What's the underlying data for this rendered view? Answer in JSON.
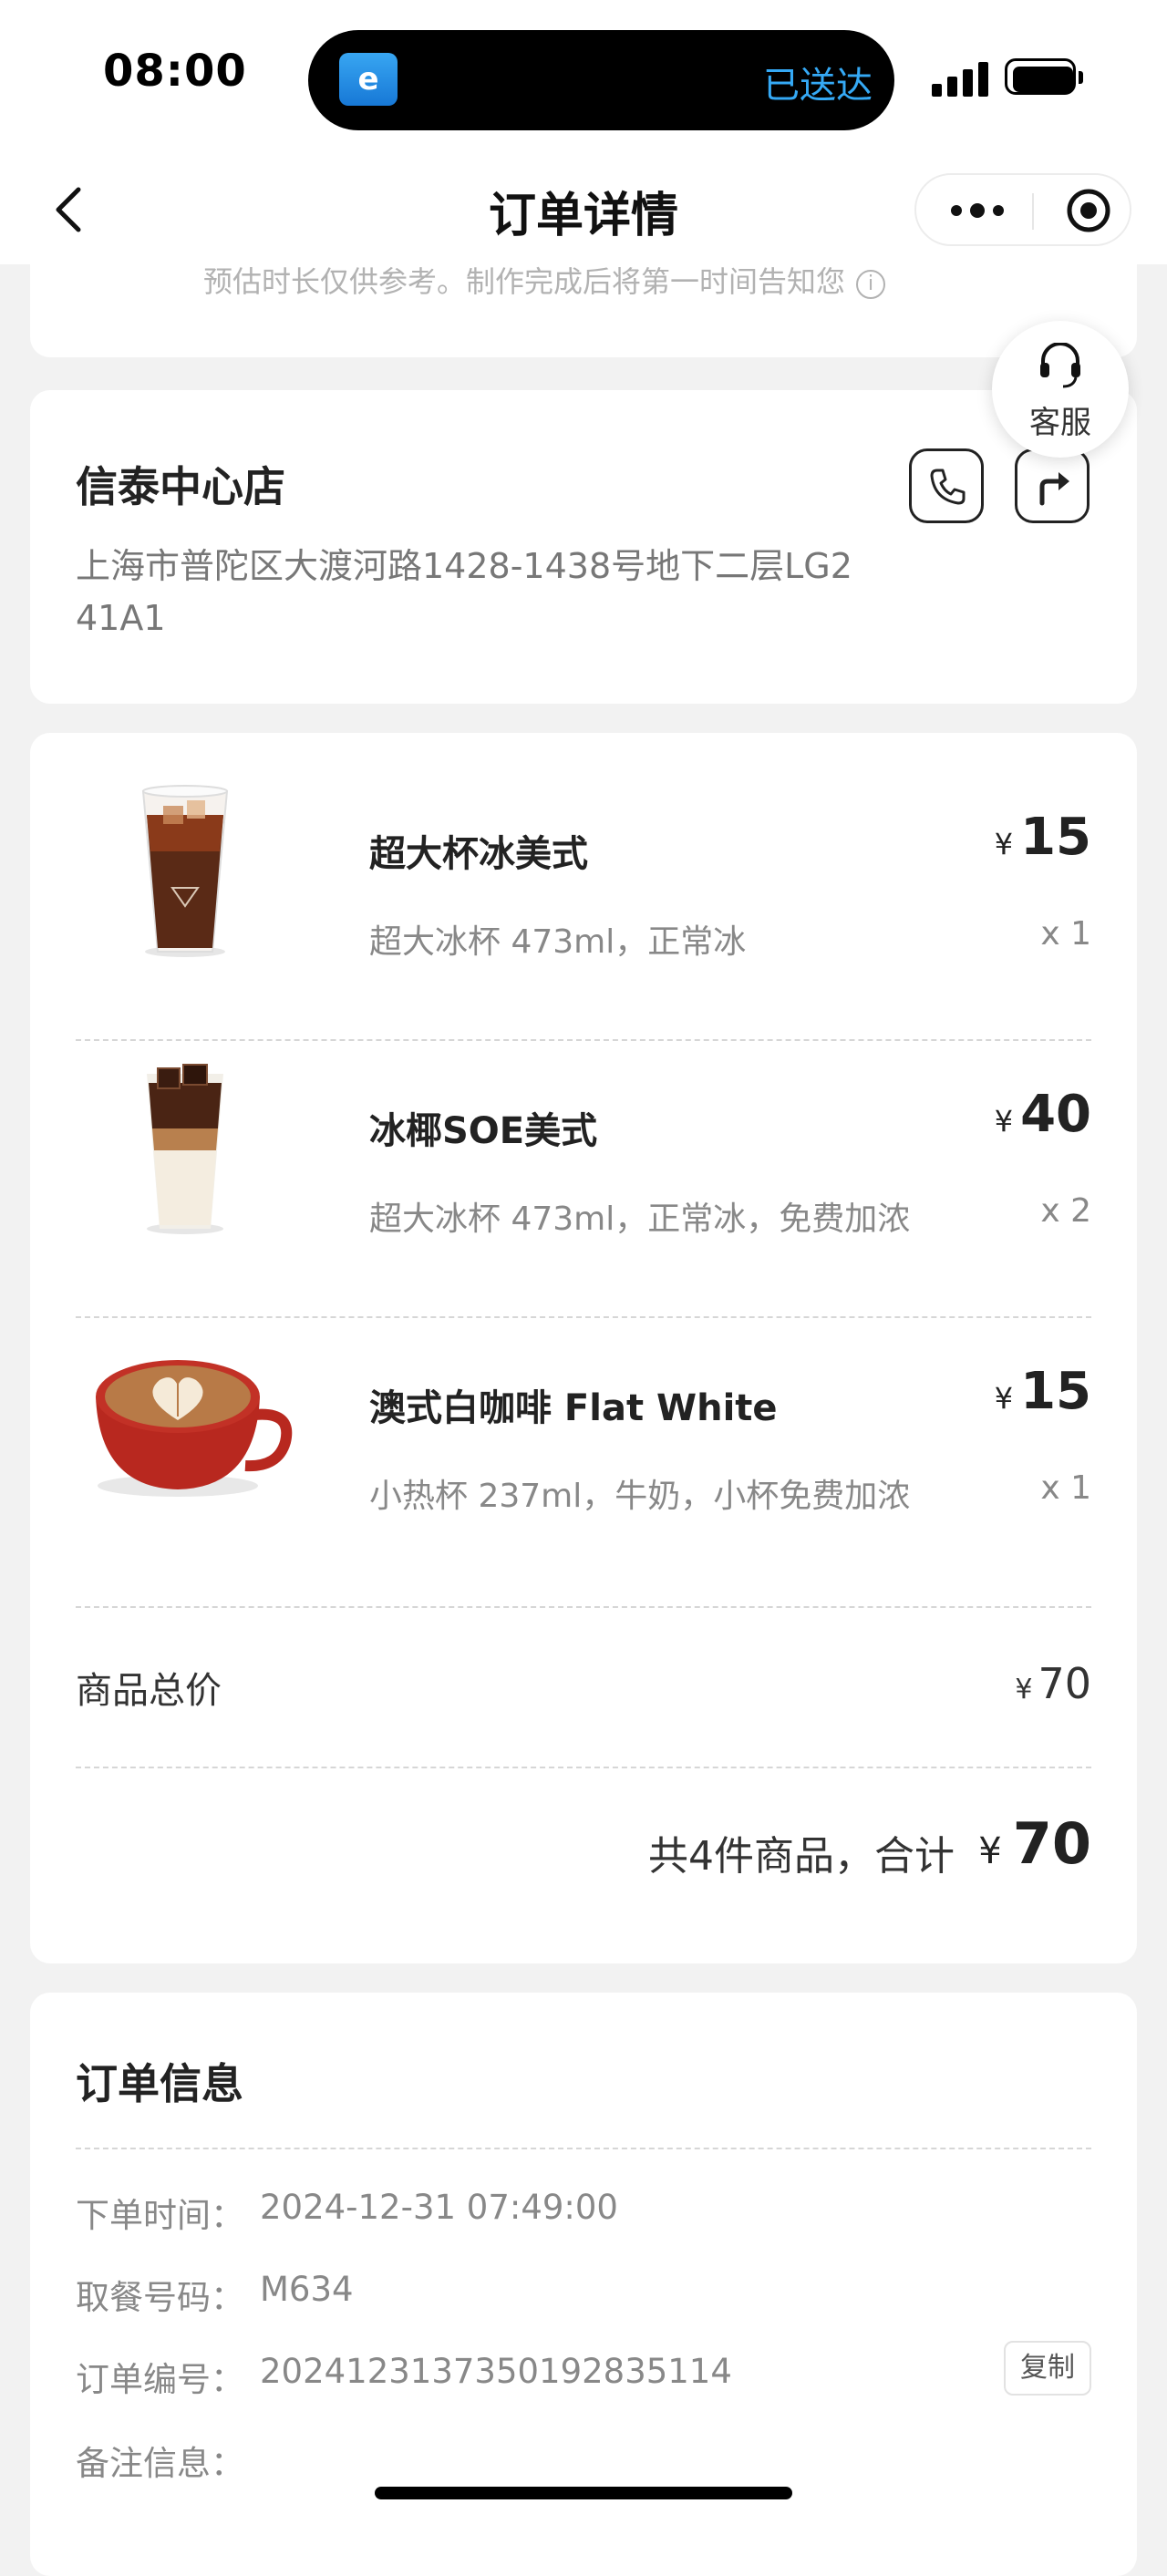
{
  "status_bar": {
    "time": "08:00",
    "island_app_icon": "eleme-app-icon",
    "island_status": "已送达",
    "island_status_color": "#35a9f5"
  },
  "nav": {
    "title": "订单详情"
  },
  "notice": {
    "text": "预估时长仅供参考。制作完成后将第一时间告知您",
    "info_icon": "i"
  },
  "customer_service": {
    "label": "客服"
  },
  "store": {
    "name": "信泰中心店",
    "address": "上海市普陀区大渡河路1428-1438号地下二层LG2 41A1"
  },
  "items": [
    {
      "name": "超大杯冰美式",
      "spec": "超大冰杯 473ml，正常冰",
      "currency": "¥",
      "price": "15",
      "qty": "x 1",
      "image": "iced-americano-cup"
    },
    {
      "name": "冰椰SOE美式",
      "spec": "超大冰杯 473ml，正常冰，免费加浓",
      "currency": "¥",
      "price": "40",
      "qty": "x 2",
      "image": "iced-coconut-americano-cup"
    },
    {
      "name": "澳式白咖啡 Flat White",
      "spec": "小热杯 237ml，牛奶，小杯免费加浓",
      "currency": "¥",
      "price": "15",
      "qty": "x 1",
      "image": "flat-white-cup"
    }
  ],
  "summary": {
    "subtotal_label": "商品总价",
    "currency": "¥",
    "subtotal_value": "70",
    "total_text": "共4件商品，合计",
    "total_value": "70"
  },
  "order_info": {
    "heading": "订单信息",
    "rows": [
      {
        "label": "下单时间：",
        "value": "2024-12-31 07:49:00"
      },
      {
        "label": "取餐号码：",
        "value": "M634"
      },
      {
        "label": "订单编号：",
        "value": "20241231373501928351​14",
        "action": "复制"
      },
      {
        "label": "备注信息：",
        "value": ""
      }
    ]
  }
}
